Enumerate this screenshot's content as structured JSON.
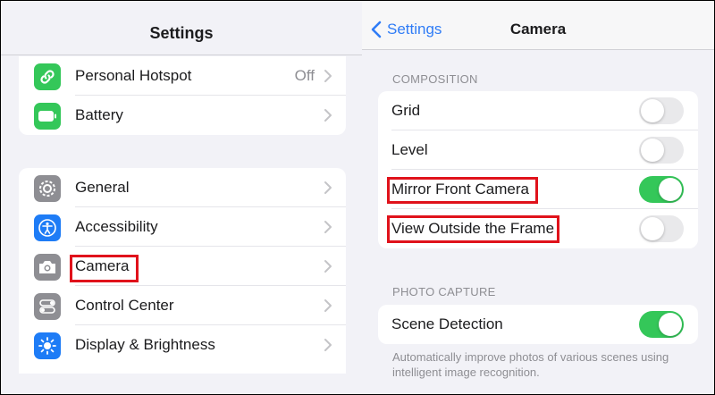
{
  "left_panel": {
    "title": "Settings",
    "group1": [
      {
        "label": "Personal Hotspot",
        "value": "Off",
        "icon": "link-icon",
        "icon_color": "#34c759"
      },
      {
        "label": "Battery",
        "value": "",
        "icon": "battery-icon",
        "icon_color": "#34c759"
      }
    ],
    "group2": [
      {
        "label": "General",
        "icon": "gear-icon",
        "icon_color": "#8e8e93"
      },
      {
        "label": "Accessibility",
        "icon": "accessibility-icon",
        "icon_color": "#1e7cf6"
      },
      {
        "label": "Camera",
        "icon": "camera-icon",
        "icon_color": "#8e8e93"
      },
      {
        "label": "Control Center",
        "icon": "toggles-icon",
        "icon_color": "#8e8e93"
      },
      {
        "label": "Display & Brightness",
        "icon": "sun-icon",
        "icon_color": "#1e7cf6"
      }
    ]
  },
  "right_panel": {
    "back_label": "Settings",
    "title": "Camera",
    "composition": {
      "header": "COMPOSITION",
      "items": [
        {
          "label": "Grid",
          "on": false
        },
        {
          "label": "Level",
          "on": false
        },
        {
          "label": "Mirror Front Camera",
          "on": true
        },
        {
          "label": "View Outside the Frame",
          "on": false
        }
      ]
    },
    "photo_capture": {
      "header": "PHOTO CAPTURE",
      "items": [
        {
          "label": "Scene Detection",
          "on": true
        }
      ],
      "footnote": "Automatically improve photos of various scenes using intelligent image recognition."
    }
  },
  "colors": {
    "accent_blue": "#2f7cf6",
    "toggle_on": "#34c759",
    "highlight_red": "#e0121b"
  }
}
